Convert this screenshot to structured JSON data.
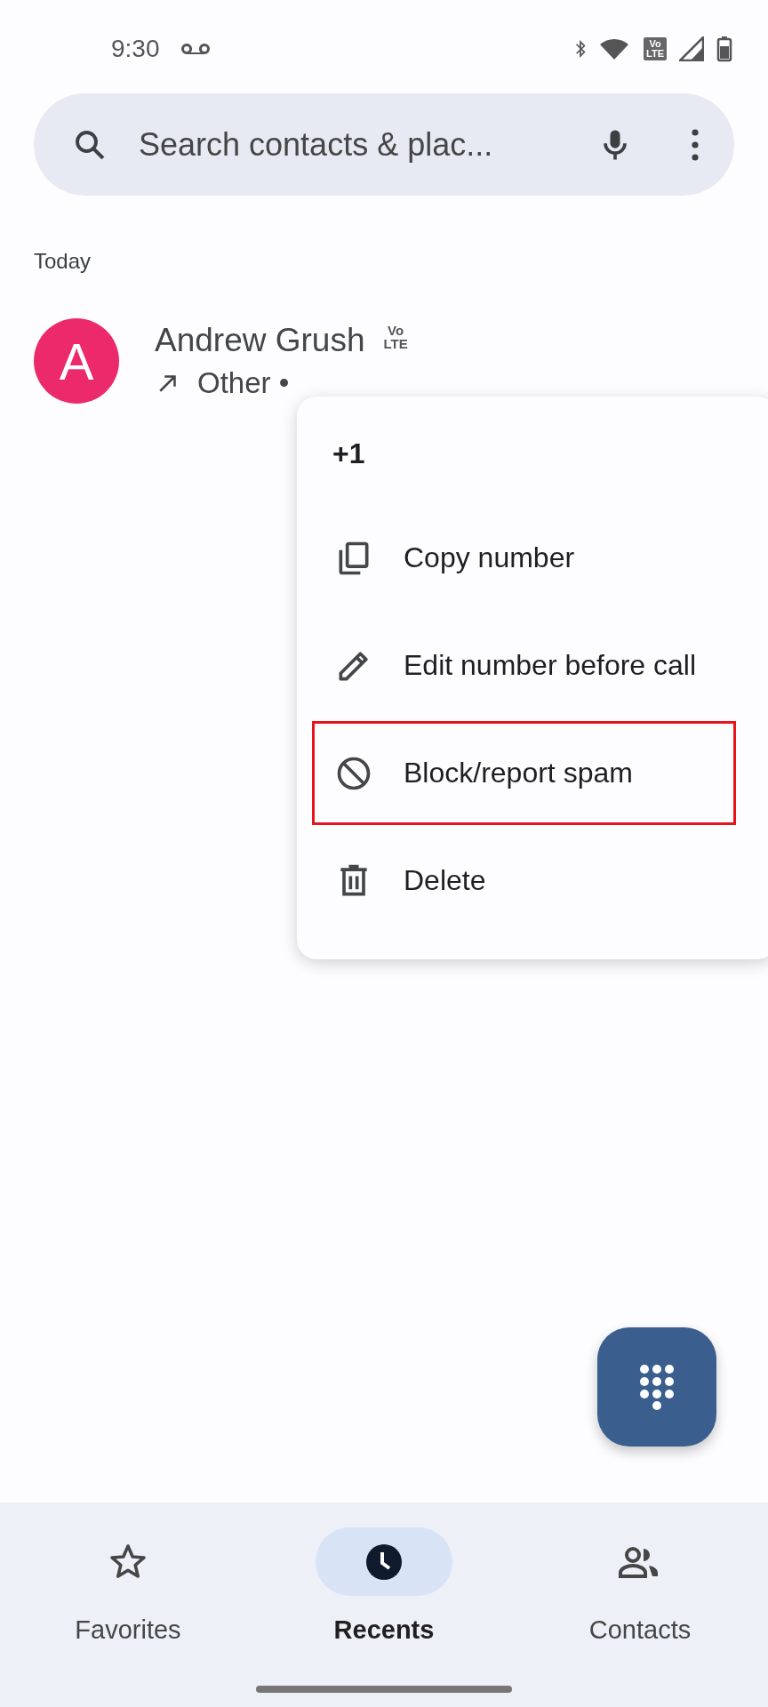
{
  "status_bar": {
    "time": "9:30",
    "volte_badge": [
      "Vo",
      "LTE"
    ]
  },
  "search": {
    "placeholder": "Search contacts & plac..."
  },
  "section_header": "Today",
  "calls": [
    {
      "initial": "A",
      "color": "#ec2a6b",
      "name": "Andrew Grush",
      "volte_badge": [
        "Vo",
        "LTE"
      ],
      "detail": "Other •"
    }
  ],
  "context_menu": {
    "header": "+1",
    "items": [
      {
        "kind": "copy",
        "label": "Copy number",
        "highlighted": false
      },
      {
        "kind": "edit",
        "label": "Edit number before call",
        "highlighted": false
      },
      {
        "kind": "block",
        "label": "Block/report spam",
        "highlighted": true
      },
      {
        "kind": "delete",
        "label": "Delete",
        "highlighted": false
      }
    ]
  },
  "bottom_nav": [
    {
      "kind": "favorites",
      "label": "Favorites",
      "selected": false
    },
    {
      "kind": "recents",
      "label": "Recents",
      "selected": true
    },
    {
      "kind": "contacts",
      "label": "Contacts",
      "selected": false
    }
  ]
}
